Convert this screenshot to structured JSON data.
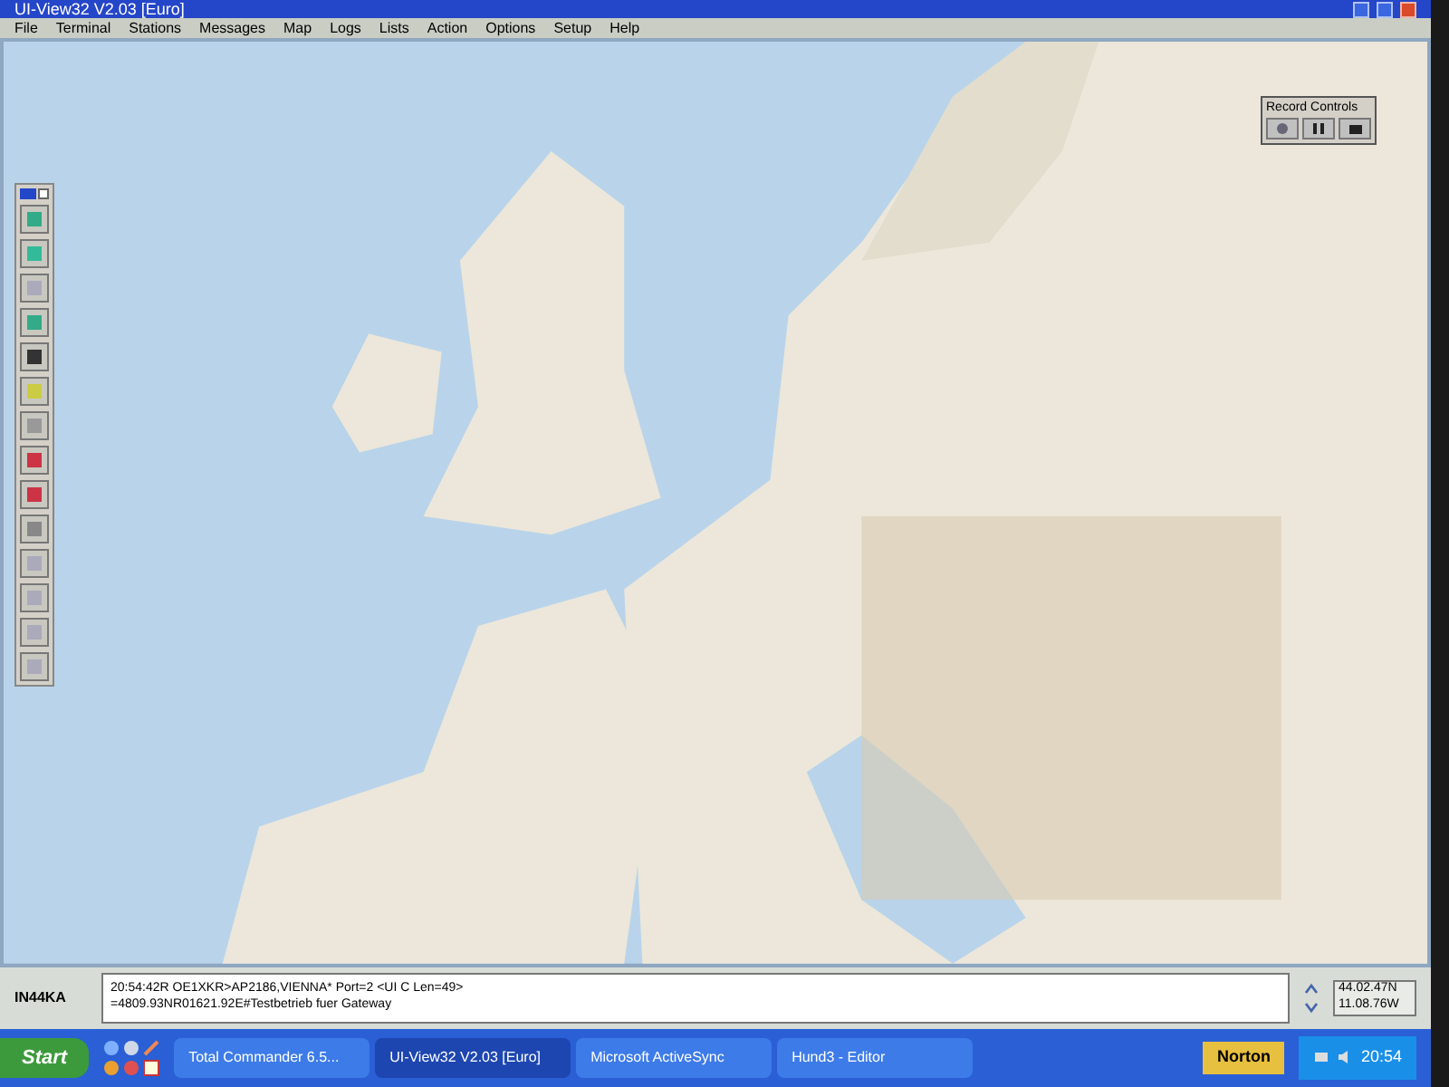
{
  "window": {
    "title": "UI-View32 V2.03 [Euro]"
  },
  "menu": [
    "File",
    "Terminal",
    "Stations",
    "Messages",
    "Map",
    "Logs",
    "Lists",
    "Action",
    "Options",
    "Setup",
    "Help"
  ],
  "record_controls": {
    "title": "Record Controls"
  },
  "status": {
    "locator": "IN44KA",
    "lines": [
      "20:54:42R OE1XKR>AP2186,VIENNA* Port=2 <UI C Len=49>",
      "=4809.93NR01621.92E#Testbetrieb fuer Gateway"
    ],
    "latitude": "44.02.47N",
    "longitude": "11.08.76W"
  },
  "taskbar": {
    "start": "Start",
    "tasks": [
      {
        "label": "Total Commander 6.5...",
        "selected": false
      },
      {
        "label": "UI-View32 V2.03 [Euro]",
        "selected": true
      },
      {
        "label": "Microsoft ActiveSync",
        "selected": false
      },
      {
        "label": "Hund3 - Editor",
        "selected": false
      }
    ],
    "tray_badge": "Norton",
    "clock": "20:54"
  }
}
